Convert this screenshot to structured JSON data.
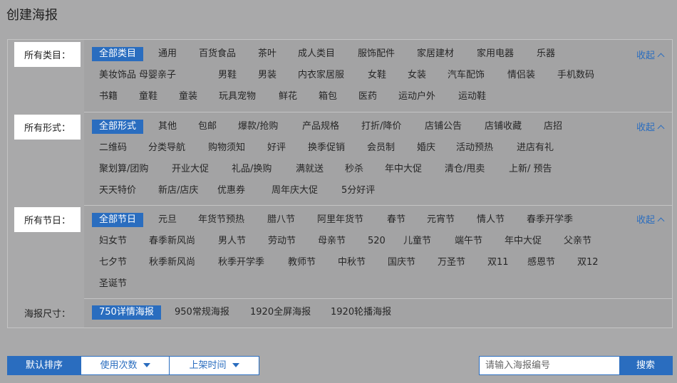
{
  "page": {
    "title": "创建海报"
  },
  "collapse_label": "收起",
  "categories": {
    "label": "所有类目：",
    "rows": [
      [
        "全部类目",
        "通用",
        "百货食品",
        "茶叶",
        "成人类目",
        "服饰配件",
        "家居建材",
        "家用电器",
        "乐器"
      ],
      [
        "美妆饰品",
        "母婴亲子",
        "男鞋",
        "男装",
        "内衣家居服",
        "女鞋",
        "女装",
        "汽车配饰",
        "情侣装",
        "手机数码"
      ],
      [
        "书籍",
        "童鞋",
        "童装",
        "玩具宠物",
        "鲜花",
        "箱包",
        "医药",
        "运动户外",
        "运动鞋"
      ]
    ]
  },
  "forms": {
    "label": "所有形式：",
    "rows": [
      [
        "全部形式",
        "其他",
        "包邮",
        "爆款/抢购",
        "产品规格",
        "打折/降价",
        "店铺公告",
        "店铺收藏",
        "店招"
      ],
      [
        "二维码",
        "分类导航",
        "购物须知",
        "好评",
        "换季促销",
        "会员制",
        "婚庆",
        "活动预热",
        "进店有礼"
      ],
      [
        "聚划算/团购",
        "开业大促",
        "礼品/换购",
        "满就送",
        "秒杀",
        "年中大促",
        "清仓/甩卖",
        "上新/ 预告"
      ],
      [
        "天天特价",
        "新店/店庆",
        "优惠券",
        "周年庆大促",
        "5分好评"
      ]
    ]
  },
  "holidays": {
    "label": "所有节日：",
    "rows": [
      [
        "全部节日",
        "元旦",
        "年货节预热",
        "腊八节",
        "阿里年货节",
        "春节",
        "元宵节",
        "情人节",
        "春季开学季"
      ],
      [
        "妇女节",
        "春季新风尚",
        "男人节",
        "劳动节",
        "母亲节",
        "520",
        "儿童节",
        "端午节",
        "年中大促",
        "父亲节"
      ],
      [
        "七夕节",
        "秋季新风尚",
        "秋季开学季",
        "教师节",
        "中秋节",
        "国庆节",
        "万圣节",
        "双11",
        "感恩节",
        "双12"
      ],
      [
        "圣诞节"
      ]
    ]
  },
  "sizes": {
    "label": "海报尺寸：",
    "items": [
      "750详情海报",
      "950常规海报",
      "1920全屏海报",
      "1920轮播海报"
    ]
  },
  "sort": {
    "default_label": "默认排序",
    "usage_label": "使用次数",
    "time_label": "上架时间"
  },
  "search": {
    "placeholder": "请输入海报编号",
    "value": "",
    "button_label": "搜索"
  },
  "colors": {
    "accent": "#2a6dbf",
    "background": "#a9a9aa"
  }
}
